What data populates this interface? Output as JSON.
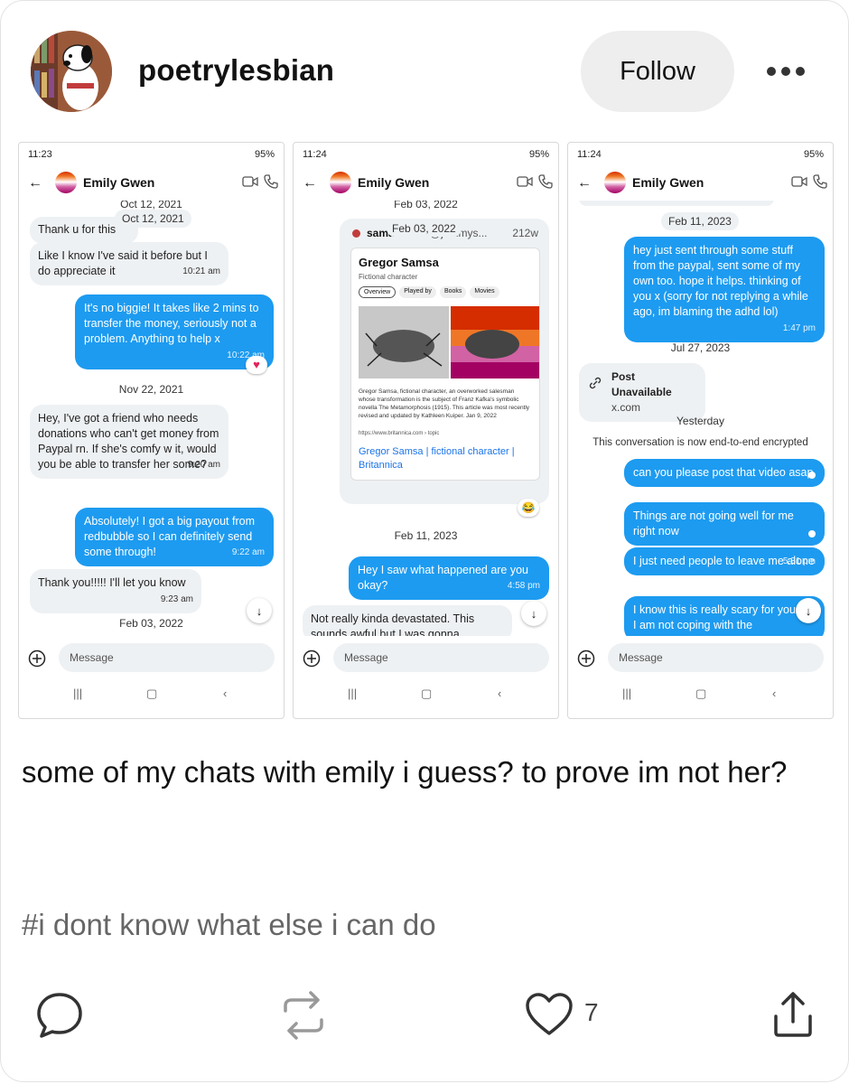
{
  "post": {
    "username": "poetrylesbian",
    "follow_label": "Follow",
    "caption": "some of my chats with emily i guess? to prove im not her?",
    "tag": "#i dont know what else i can do",
    "likes": "7"
  },
  "shots": [
    {
      "time": "11:23",
      "status": "95%",
      "contact": "Emily Gwen",
      "date_top": "Oct 12, 2021",
      "date_pill": "Oct 12, 2021",
      "msg1": "Thank u for this",
      "msg2": "Like I know I've said it before but I do appreciate it",
      "msg2_time": "10:21 am",
      "msg3": "It's no biggie! It takes like 2 mins to transfer the money, seriously not a problem. Anything to help x",
      "msg3_time": "10:22 am",
      "date2": "Nov 22, 2021",
      "msg4": "Hey, I've got a friend who needs donations who can't get money from Paypal rn. If she's comfy w it, would you be able to transfer her some?",
      "msg4_time": "9:20 am",
      "msg5": "Absolutely! I got a big payout from redbubble so I can definitely send some through!",
      "msg5_time": "9:22 am",
      "msg6": "Thank you!!!!! I'll let you know",
      "msg6_time": "9:23 am",
      "date3": "Feb 03, 2022",
      "compose": "Message"
    },
    {
      "time": "11:24",
      "status": "95%",
      "contact": "Emily Gwen",
      "date_top": "Feb 03, 2022",
      "date_pill": "Feb 03, 2022",
      "embed_user": "samantha",
      "embed_handle": "@jammys...",
      "embed_age": "212w",
      "g_title": "Gregor Samsa",
      "g_sub": "Fictional character",
      "tabs": [
        "Overview",
        "Played by",
        "Books",
        "Movies"
      ],
      "g_desc": "Gregor Samsa, fictional character, an overworked salesman whose transformation is the subject of Franz Kafka's symbolic novella The Metamorphosis (1915). This article was most recently revised and updated by Kathleen Kuiper. Jan 9, 2022",
      "g_url": "https://www.britannica.com › topic",
      "g_link": "Gregor Samsa | fictional character | Britannica",
      "reaction": "😂",
      "date2": "Feb 11, 2023",
      "msg1": "Hey I saw what happened are you okay?",
      "msg1_time": "4:58 pm",
      "msg2": "Not really kinda devastated. This sounds awful but I was gonna",
      "compose": "Message"
    },
    {
      "time": "11:24",
      "status": "95%",
      "contact": "Emily Gwen",
      "date1": "Feb 11, 2023",
      "msg1": "hey just sent through some stuff from the paypal, sent some of my own too. hope it helps. thinking of you x (sorry for not replying a while ago, im blaming the adhd lol)",
      "msg1_time": "1:47 pm",
      "date2": "Jul 27, 2023",
      "post_unavail": "Post Unavailable",
      "post_domain": "x.com",
      "date3": "Yesterday",
      "encrypted": "This conversation is now end-to-end encrypted",
      "msg2": "can you please post that video asap",
      "msg3": "Things are not going well for me right now",
      "msg4": "I just need people to leave me alone",
      "msg4_time": "5:31 pm",
      "msg5": "I know this is really scary for you but I am not coping with the",
      "compose": "Message"
    }
  ],
  "colors": {
    "accent": "#1d9bf0",
    "bubble_in": "#eef1f3",
    "follow_bg": "#eeeeee"
  }
}
